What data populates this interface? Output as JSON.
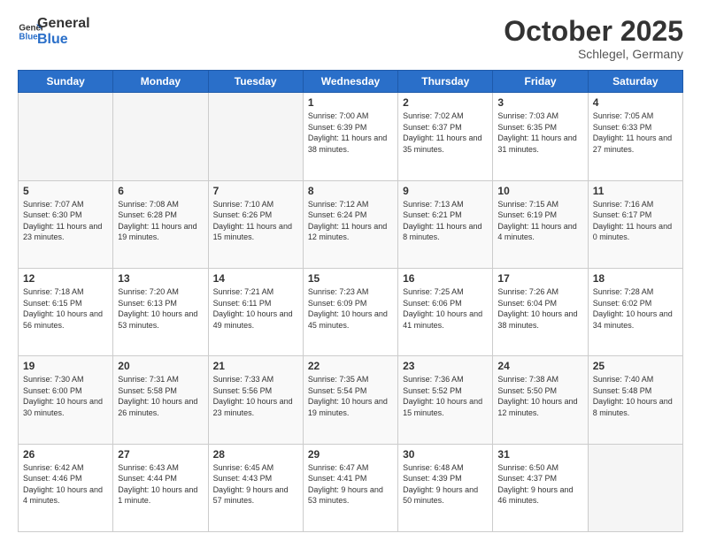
{
  "header": {
    "logo_line1": "General",
    "logo_line2": "Blue",
    "month": "October 2025",
    "location": "Schlegel, Germany"
  },
  "weekdays": [
    "Sunday",
    "Monday",
    "Tuesday",
    "Wednesday",
    "Thursday",
    "Friday",
    "Saturday"
  ],
  "weeks": [
    [
      {
        "day": "",
        "info": ""
      },
      {
        "day": "",
        "info": ""
      },
      {
        "day": "",
        "info": ""
      },
      {
        "day": "1",
        "info": "Sunrise: 7:00 AM\nSunset: 6:39 PM\nDaylight: 11 hours\nand 38 minutes."
      },
      {
        "day": "2",
        "info": "Sunrise: 7:02 AM\nSunset: 6:37 PM\nDaylight: 11 hours\nand 35 minutes."
      },
      {
        "day": "3",
        "info": "Sunrise: 7:03 AM\nSunset: 6:35 PM\nDaylight: 11 hours\nand 31 minutes."
      },
      {
        "day": "4",
        "info": "Sunrise: 7:05 AM\nSunset: 6:33 PM\nDaylight: 11 hours\nand 27 minutes."
      }
    ],
    [
      {
        "day": "5",
        "info": "Sunrise: 7:07 AM\nSunset: 6:30 PM\nDaylight: 11 hours\nand 23 minutes."
      },
      {
        "day": "6",
        "info": "Sunrise: 7:08 AM\nSunset: 6:28 PM\nDaylight: 11 hours\nand 19 minutes."
      },
      {
        "day": "7",
        "info": "Sunrise: 7:10 AM\nSunset: 6:26 PM\nDaylight: 11 hours\nand 15 minutes."
      },
      {
        "day": "8",
        "info": "Sunrise: 7:12 AM\nSunset: 6:24 PM\nDaylight: 11 hours\nand 12 minutes."
      },
      {
        "day": "9",
        "info": "Sunrise: 7:13 AM\nSunset: 6:21 PM\nDaylight: 11 hours\nand 8 minutes."
      },
      {
        "day": "10",
        "info": "Sunrise: 7:15 AM\nSunset: 6:19 PM\nDaylight: 11 hours\nand 4 minutes."
      },
      {
        "day": "11",
        "info": "Sunrise: 7:16 AM\nSunset: 6:17 PM\nDaylight: 11 hours\nand 0 minutes."
      }
    ],
    [
      {
        "day": "12",
        "info": "Sunrise: 7:18 AM\nSunset: 6:15 PM\nDaylight: 10 hours\nand 56 minutes."
      },
      {
        "day": "13",
        "info": "Sunrise: 7:20 AM\nSunset: 6:13 PM\nDaylight: 10 hours\nand 53 minutes."
      },
      {
        "day": "14",
        "info": "Sunrise: 7:21 AM\nSunset: 6:11 PM\nDaylight: 10 hours\nand 49 minutes."
      },
      {
        "day": "15",
        "info": "Sunrise: 7:23 AM\nSunset: 6:09 PM\nDaylight: 10 hours\nand 45 minutes."
      },
      {
        "day": "16",
        "info": "Sunrise: 7:25 AM\nSunset: 6:06 PM\nDaylight: 10 hours\nand 41 minutes."
      },
      {
        "day": "17",
        "info": "Sunrise: 7:26 AM\nSunset: 6:04 PM\nDaylight: 10 hours\nand 38 minutes."
      },
      {
        "day": "18",
        "info": "Sunrise: 7:28 AM\nSunset: 6:02 PM\nDaylight: 10 hours\nand 34 minutes."
      }
    ],
    [
      {
        "day": "19",
        "info": "Sunrise: 7:30 AM\nSunset: 6:00 PM\nDaylight: 10 hours\nand 30 minutes."
      },
      {
        "day": "20",
        "info": "Sunrise: 7:31 AM\nSunset: 5:58 PM\nDaylight: 10 hours\nand 26 minutes."
      },
      {
        "day": "21",
        "info": "Sunrise: 7:33 AM\nSunset: 5:56 PM\nDaylight: 10 hours\nand 23 minutes."
      },
      {
        "day": "22",
        "info": "Sunrise: 7:35 AM\nSunset: 5:54 PM\nDaylight: 10 hours\nand 19 minutes."
      },
      {
        "day": "23",
        "info": "Sunrise: 7:36 AM\nSunset: 5:52 PM\nDaylight: 10 hours\nand 15 minutes."
      },
      {
        "day": "24",
        "info": "Sunrise: 7:38 AM\nSunset: 5:50 PM\nDaylight: 10 hours\nand 12 minutes."
      },
      {
        "day": "25",
        "info": "Sunrise: 7:40 AM\nSunset: 5:48 PM\nDaylight: 10 hours\nand 8 minutes."
      }
    ],
    [
      {
        "day": "26",
        "info": "Sunrise: 6:42 AM\nSunset: 4:46 PM\nDaylight: 10 hours\nand 4 minutes."
      },
      {
        "day": "27",
        "info": "Sunrise: 6:43 AM\nSunset: 4:44 PM\nDaylight: 10 hours\nand 1 minute."
      },
      {
        "day": "28",
        "info": "Sunrise: 6:45 AM\nSunset: 4:43 PM\nDaylight: 9 hours\nand 57 minutes."
      },
      {
        "day": "29",
        "info": "Sunrise: 6:47 AM\nSunset: 4:41 PM\nDaylight: 9 hours\nand 53 minutes."
      },
      {
        "day": "30",
        "info": "Sunrise: 6:48 AM\nSunset: 4:39 PM\nDaylight: 9 hours\nand 50 minutes."
      },
      {
        "day": "31",
        "info": "Sunrise: 6:50 AM\nSunset: 4:37 PM\nDaylight: 9 hours\nand 46 minutes."
      },
      {
        "day": "",
        "info": ""
      }
    ]
  ]
}
